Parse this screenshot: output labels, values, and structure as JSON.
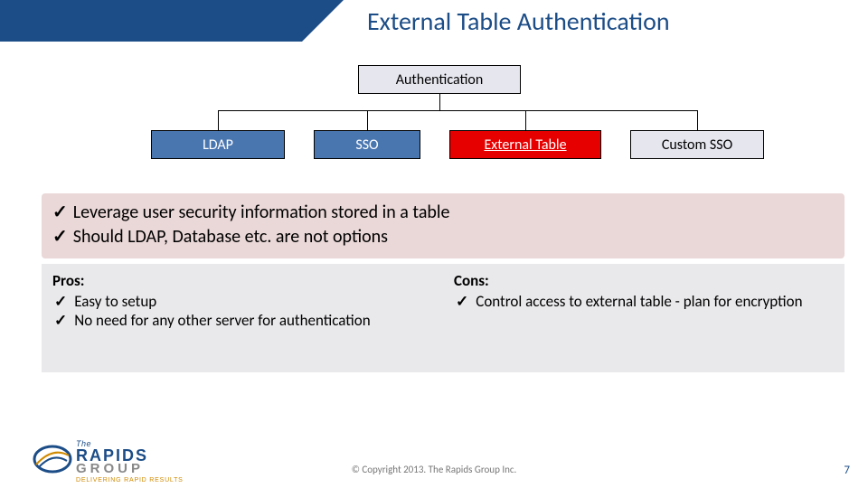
{
  "title": "External Table Authentication",
  "org": {
    "root": "Authentication",
    "children": [
      "LDAP",
      "SSO",
      "External Table",
      "Custom SSO"
    ]
  },
  "leverage": [
    "Leverage user security information stored in a table",
    "Should LDAP, Database etc. are not options"
  ],
  "pros": {
    "heading": "Pros:",
    "items": [
      "Easy to setup",
      "No need for any other server for authentication"
    ]
  },
  "cons": {
    "heading": "Cons:",
    "items": [
      "Control access to external table - plan for encryption"
    ]
  },
  "footer": {
    "copyright": "© Copyright 2013. The Rapids Group Inc.",
    "page": "7"
  },
  "logo": {
    "the": "The",
    "rapids": "RAPIDS",
    "group": "GROUP",
    "tagline": "DELIVERING RAPID RESULTS"
  }
}
